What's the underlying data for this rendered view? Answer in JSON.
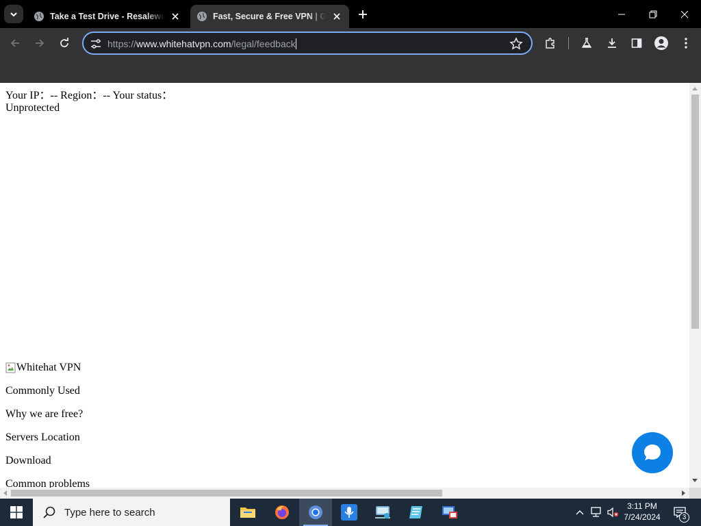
{
  "browser": {
    "tabs": [
      {
        "title": "Take a Test Drive - Resaleworld",
        "active": false
      },
      {
        "title": "Fast, Secure & Free VPN | Get on",
        "active": true
      }
    ],
    "url": {
      "scheme": "https://",
      "host": "www.whitehatvpn.com",
      "path": "/legal/feedback"
    }
  },
  "page": {
    "status_line": "Your IP：-- Region：-- Your status：Unprotected",
    "logo_alt": "Whitehat VPN",
    "nav": [
      "Commonly Used",
      "Why we are free?",
      "Servers Location",
      "Download",
      "Common problems"
    ],
    "chat_button_color": "#0d80e6"
  },
  "taskbar": {
    "search_placeholder": "Type here to search",
    "time": "3:11 PM",
    "date": "7/24/2024",
    "notification_count": "3",
    "apps": [
      "file-explorer",
      "firefox",
      "chrome",
      "mic-app",
      "network-app",
      "notes-app",
      "remote-desktop-app"
    ]
  },
  "colors": {
    "accent": "#7cacf8",
    "browser_bg": "#333336",
    "taskbar_bg": "#1c2a3a"
  }
}
